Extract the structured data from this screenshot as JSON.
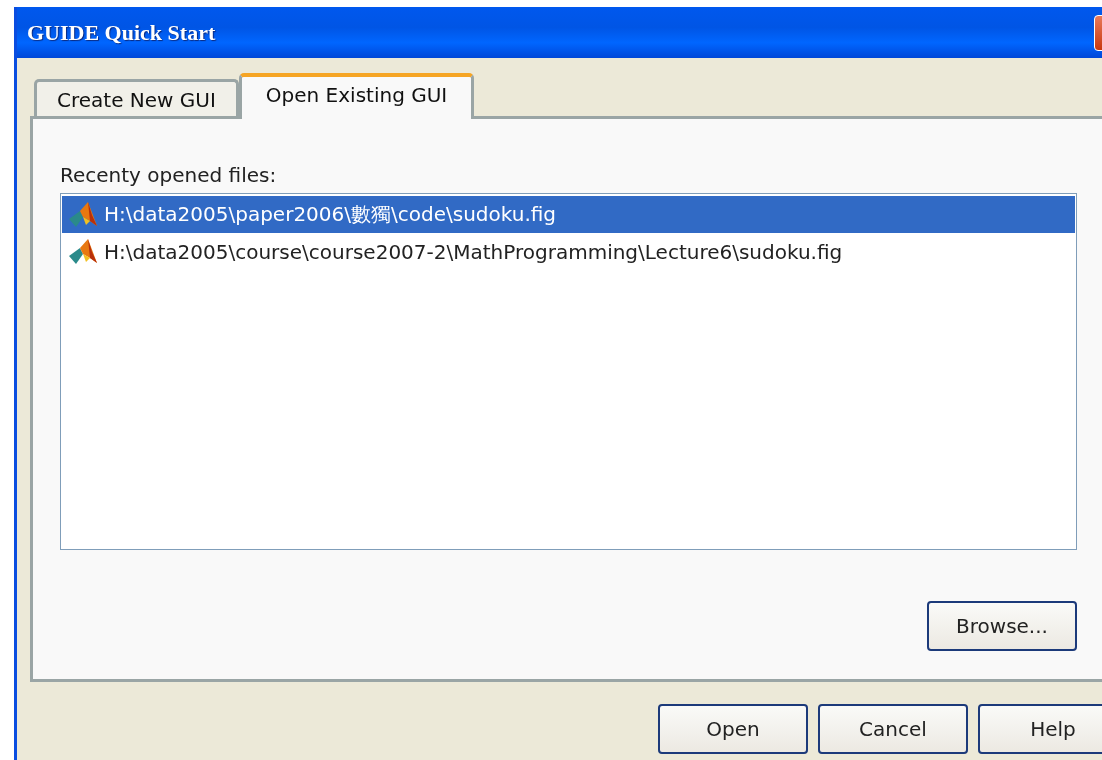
{
  "window": {
    "title": "GUIDE Quick Start"
  },
  "tabs": [
    {
      "label": "Create New GUI",
      "selected": false
    },
    {
      "label": "Open Existing GUI",
      "selected": true
    }
  ],
  "recent_label": "Recenty opened files:",
  "files": [
    {
      "path": "H:\\data2005\\paper2006\\數獨\\code\\sudoku.fig",
      "selected": true
    },
    {
      "path": "H:\\data2005\\course\\course2007-2\\MathProgramming\\Lecture6\\sudoku.fig",
      "selected": false
    }
  ],
  "browse_button": "Browse...",
  "buttons": [
    "Open",
    "Cancel",
    "Help"
  ]
}
